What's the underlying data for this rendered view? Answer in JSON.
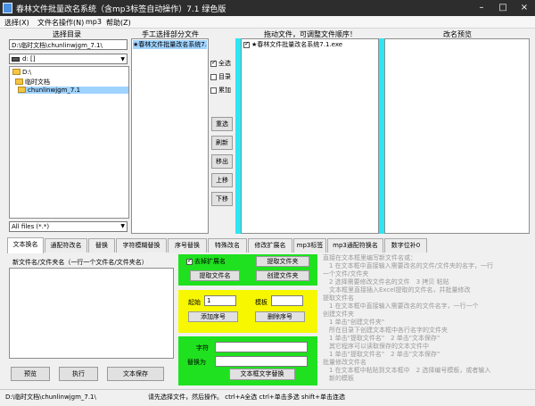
{
  "titlebar": {
    "title": "春林文件批量改名系统（含mp3标签自动操作）7.1 绿色版",
    "minimize": "–",
    "maximize": "□",
    "close": "×"
  },
  "menubar": {
    "items": [
      "选择(X)",
      "文件名操作(N)",
      "mp3",
      "帮助(Z)"
    ]
  },
  "left_panel": {
    "header": "选择目录",
    "path": "D:\\临时文档\\chunlinwjgm_7.1\\",
    "drive": "d: []",
    "tree": [
      "D:\\",
      "临时文档",
      "chunlinwjgm_7.1"
    ],
    "filter": "All files (*.*)"
  },
  "middle_panel": {
    "header": "手工选择部分文件",
    "file": "★春林文件批量改名系统7.1.exe"
  },
  "options": {
    "select_all": "全选",
    "directory": "目录",
    "accumulate": "累加"
  },
  "side_buttons": {
    "reselect": "重选",
    "refresh": "刷新",
    "remove": "移出",
    "move_up": "上移",
    "move_down": "下移"
  },
  "drag_panel": {
    "header": "拖动文件，可调整文件顺序！",
    "file": "★春林文件批量改名系统7.1.exe"
  },
  "preview_panel": {
    "header": "改名预览"
  },
  "tabs": [
    "文本换名",
    "通配符改名",
    "替换",
    "字符模糊替换",
    "序号替换",
    "特殊改名",
    "修改扩展名",
    "mp3标签",
    "mp3通配符换名",
    "数字位补0"
  ],
  "text_rename": {
    "label": "新文件名/文件夹名（一行一个文件名/文件夹名）",
    "preview_btn": "预览",
    "execute_btn": "执行",
    "save_btn": "文本保存"
  },
  "green_top": {
    "select_ext": "去掉扩展名",
    "get_folder": "提取文件夹",
    "get_file": "提取文件名",
    "create_folder": "创建文件夹"
  },
  "yellow_box": {
    "start_label": "起始",
    "start_value": "1",
    "template_label": "模板",
    "add_seq": "添加序号",
    "del_seq": "删除序号"
  },
  "green_bottom": {
    "char_label": "字符",
    "replace_label": "替换为",
    "replace_btn": "文本框文字替换"
  },
  "instructions": [
    "直接在文本框里编写新文件名或：",
    "　1 在文本框中直接输入需要改名的文件/文件夹的名字，一行",
    "一个文件/文件夹",
    "　2 选择需要修改文件名的文件　3 拷贝 粘贴",
    "　文本框里直接插入Excel提取的文件名，并批量修改",
    "提取文件名",
    "　1 在文本框中直接输入需要改名的文件名字，一行一个",
    "创建文件夹",
    "　1 单击\"创建文件夹\"",
    "　所在目录下创建文本框中各行名字的文件夹",
    "　1 单击\"提取文件名\"　2 单击\"文本保存\"",
    "　其它程序可以读取保存的文本文件中",
    "　1 单击\"提取文件名\"　2 单击\"文本保存\"",
    "批量修改文件名",
    "　1 在文本框中粘贴到文本框中　2 选择编号模板，或者输入",
    "　新的模板"
  ],
  "status": {
    "path": "D:\\临时文档\\chunlinwjgm_7.1\\",
    "hint": "请先选择文件，然后操作。 ctrl+A全选 ctrl+单击多选 shift+单击连选"
  }
}
